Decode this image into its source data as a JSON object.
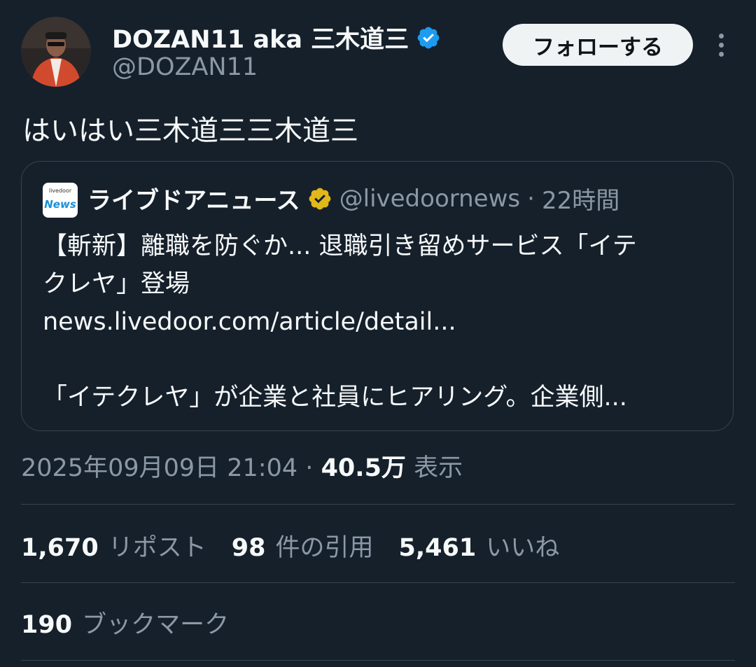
{
  "header": {
    "display_name": "DOZAN11 aka 三木道三",
    "handle": "@DOZAN11",
    "follow_label": "フォローする"
  },
  "tweet": {
    "text": "はいはい三木道三三木道三"
  },
  "quote": {
    "logo_small": "livedoor",
    "logo_big": "News",
    "name": "ライブドアニュース",
    "handle": "@livedoornews",
    "separator": "·",
    "time": "22時間",
    "line1": "【斬新】離職を防ぐか... 退職引き留めサービス「イテ",
    "line2": "クレヤ」登場",
    "link": "news.livedoor.com/article/detail...",
    "line3": "「イテクレヤ」が企業と社員にヒアリング。企業側..."
  },
  "meta": {
    "timestamp": "2025年09月09日 21:04",
    "separator": "·",
    "views_count": "40.5万",
    "views_label": "表示"
  },
  "stats": {
    "reposts_count": "1,670",
    "reposts_label": "リポスト",
    "quotes_count": "98",
    "quotes_label": "件の引用",
    "likes_count": "5,461",
    "likes_label": "いいね",
    "bookmarks_count": "190",
    "bookmarks_label": "ブックマーク"
  },
  "colors": {
    "background": "#15202b",
    "verified_blue": "#1d9bf0",
    "verified_gold": "#e2b719",
    "secondary_text": "#8b98a5",
    "border": "#38444d"
  },
  "icons": {
    "verified": "verified-badge-icon",
    "gold_verified": "gold-verified-badge-icon",
    "more": "more-options-icon"
  }
}
